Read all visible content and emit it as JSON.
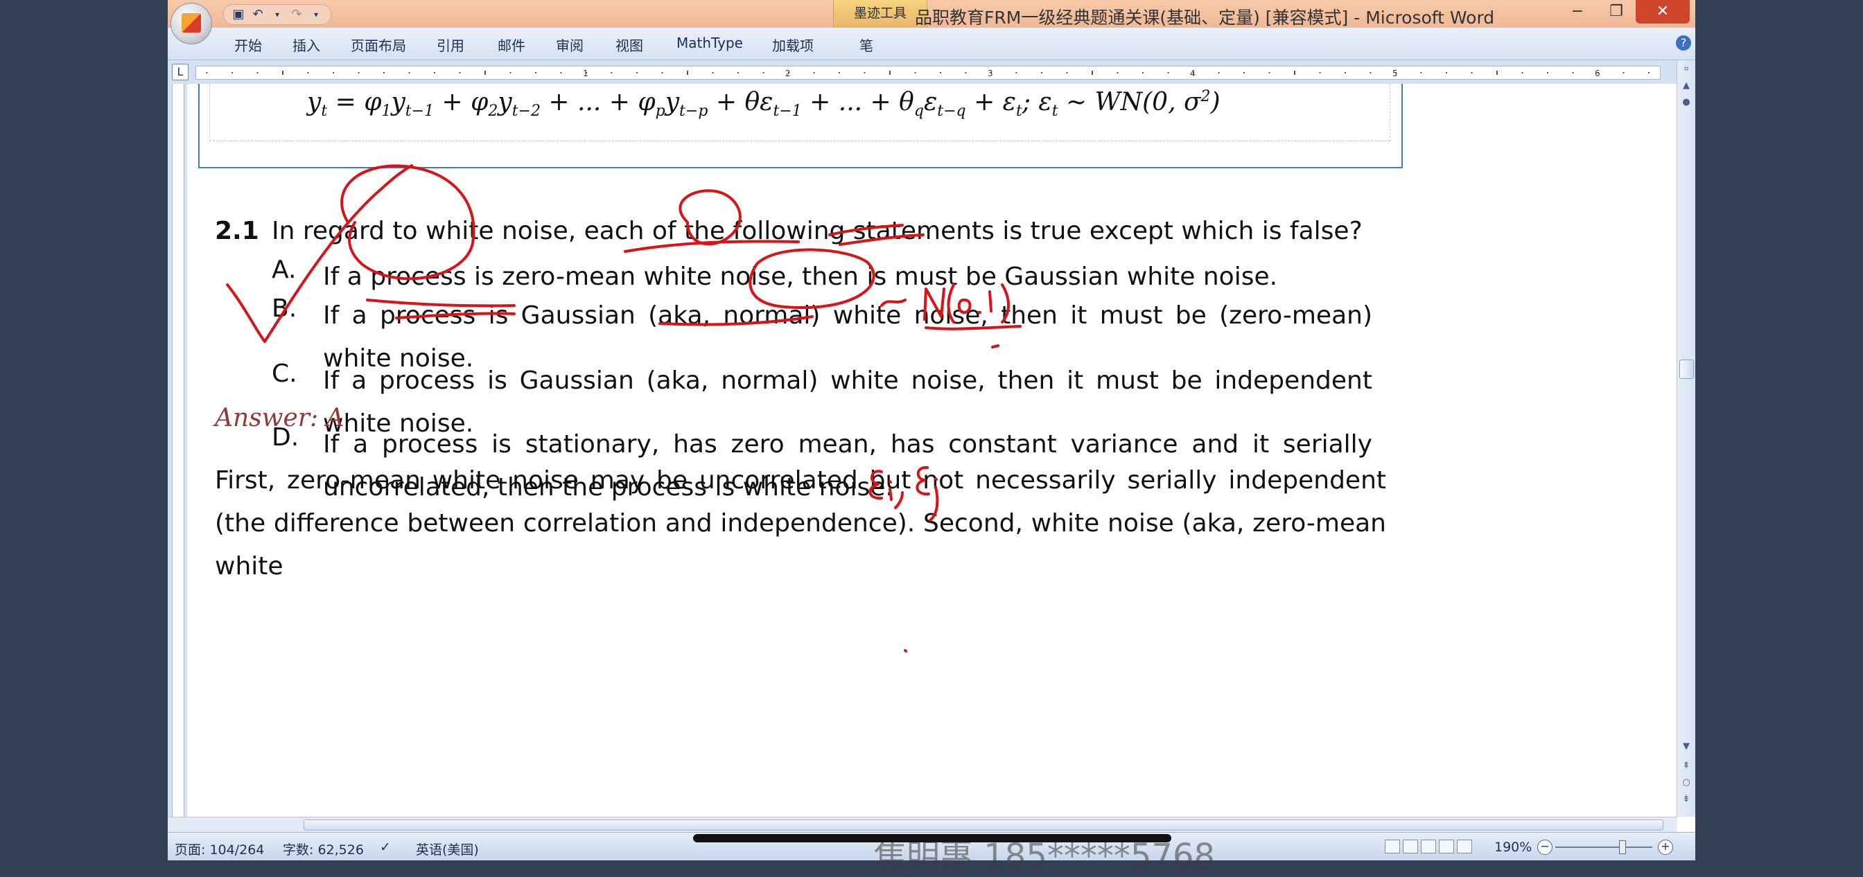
{
  "window": {
    "title": "品职教育FRM一级经典题通关课(基础、定量) [兼容模式] - Microsoft Word",
    "contextual_tab": "墨迹工具",
    "controls": [
      "−",
      "❐",
      "✕"
    ]
  },
  "quick_access": {
    "save_icon": "save-icon",
    "undo_icon": "undo-icon",
    "redo_icon": "redo-icon"
  },
  "ribbon_tabs": [
    "开始",
    "插入",
    "页面布局",
    "引用",
    "邮件",
    "审阅",
    "视图",
    "MathType",
    "加载项",
    "笔"
  ],
  "document": {
    "formula_lhs": "y",
    "formula": "= φ₁y  + φ₂y  + ... + φₚy  + θε  + ... + θ_q ε  + ε ; ε ~ WN(0, σ²)",
    "question_number": "2.1",
    "question_text": "In regard to white noise, each of the following statements is true except which is false?",
    "options": [
      {
        "letter": "A.",
        "text": "If a process is zero-mean white noise, then is must be Gaussian white noise."
      },
      {
        "letter": "B.",
        "text": "If a process is Gaussian (aka, normal) white noise, then it must be (zero-mean) white noise."
      },
      {
        "letter": "C.",
        "text": "If a process is Gaussian (aka, normal) white noise, then it must be independent white noise."
      },
      {
        "letter": "D.",
        "text": "If a process is stationary, has zero mean, has constant variance and it serially uncorrelated, then the process is white noise."
      }
    ],
    "answer": "Answer: A",
    "explanation": "First, zero-mean white noise may be uncorrelated but not necessarily serially independent (the difference between correlation and independence). Second, white noise (aka, zero-mean white"
  },
  "status": {
    "page": "页面: 104/264",
    "words": "字数: 62,526",
    "language": "英语(美国)",
    "zoom": "190%"
  },
  "watermark": "焦明惠 185*****5768",
  "colors": {
    "ink": "#d8141b",
    "accent": "#3f7fb8",
    "answer": "#8f3b3b"
  }
}
